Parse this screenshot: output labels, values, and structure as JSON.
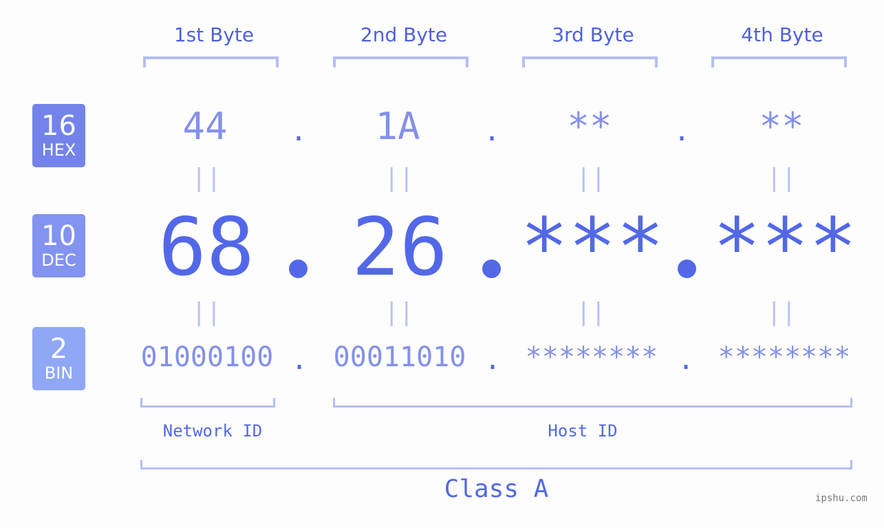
{
  "byte_headers": [
    "1st Byte",
    "2nd Byte",
    "3rd Byte",
    "4th Byte"
  ],
  "bases": [
    {
      "number": "16",
      "label": "HEX",
      "color": "#7383ea"
    },
    {
      "number": "10",
      "label": "DEC",
      "color": "#8293f0"
    },
    {
      "number": "2",
      "label": "BIN",
      "color": "#90a7f6"
    }
  ],
  "hex": [
    "44",
    "1A",
    "**",
    "**"
  ],
  "dec": [
    "68",
    "26",
    "***",
    "***"
  ],
  "bin": [
    "01000100",
    "00011010",
    "********",
    "********"
  ],
  "separator": ".",
  "equals": "||",
  "network_id_label": "Network ID",
  "host_id_label": "Host ID",
  "class_label": "Class A",
  "watermark": "ipshu.com"
}
